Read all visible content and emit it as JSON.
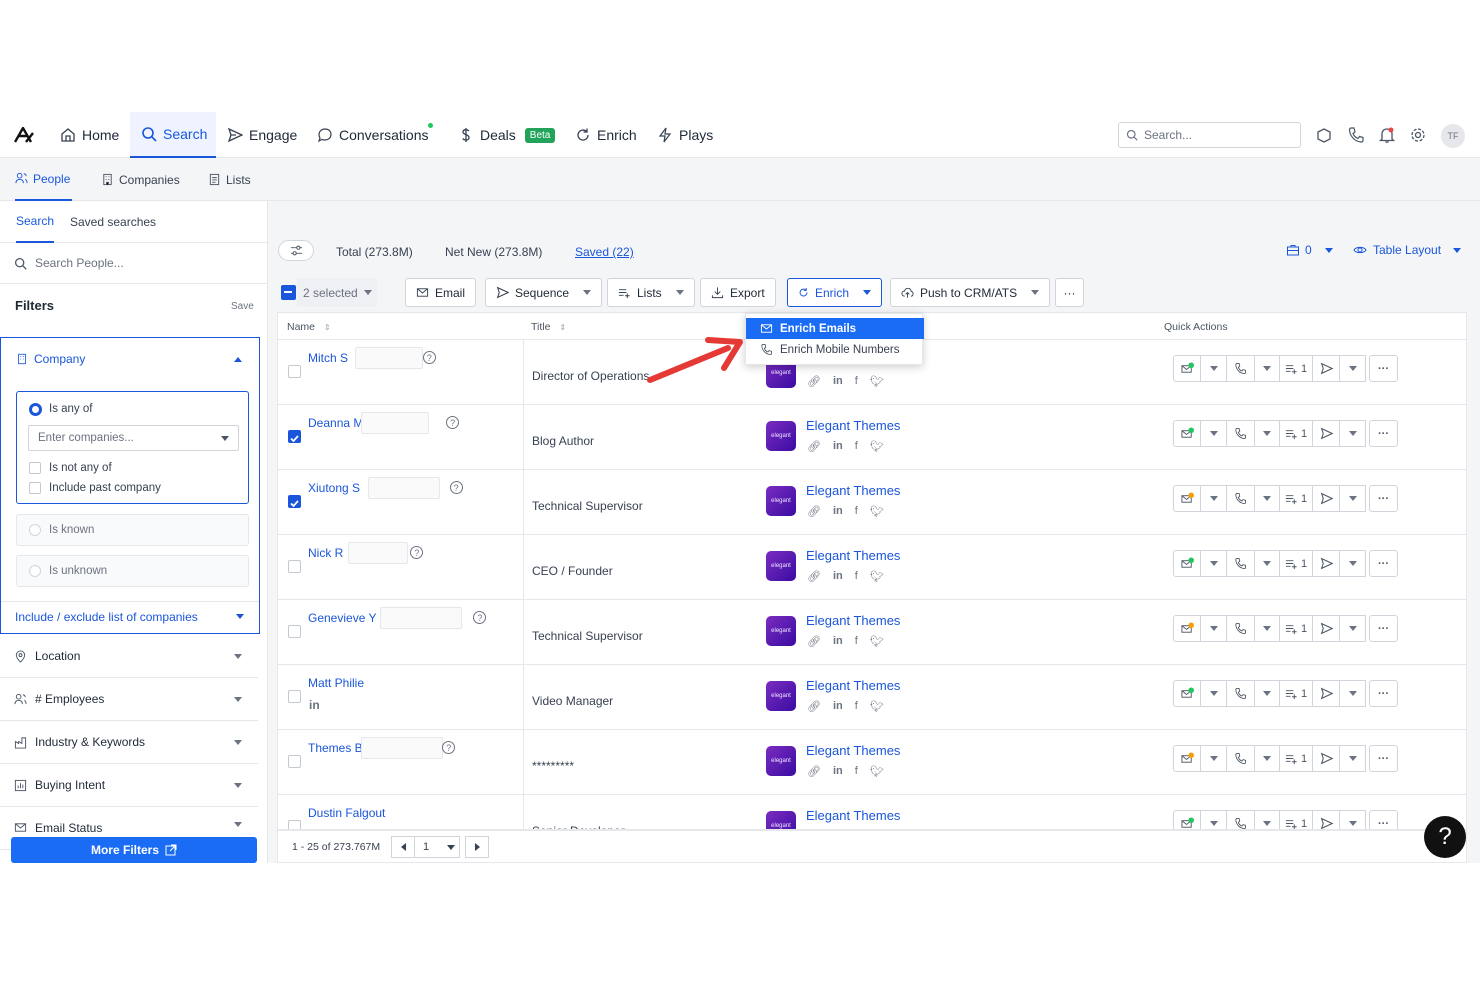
{
  "nav": {
    "items": [
      {
        "label": "Home",
        "icon": "home-icon"
      },
      {
        "label": "Search",
        "icon": "search-icon"
      },
      {
        "label": "Engage",
        "icon": "send-icon"
      },
      {
        "label": "Conversations",
        "icon": "chat-icon"
      },
      {
        "label": "Deals",
        "icon": "dollar-icon",
        "badge": "Beta"
      },
      {
        "label": "Enrich",
        "icon": "refresh-icon"
      },
      {
        "label": "Plays",
        "icon": "bolt-icon"
      }
    ],
    "search_placeholder": "Search...",
    "avatar": "TF"
  },
  "subnav": {
    "items": [
      "People",
      "Companies",
      "Lists"
    ]
  },
  "sidebar": {
    "tabs": [
      "Search",
      "Saved searches"
    ],
    "search_placeholder": "Search People...",
    "filters_title": "Filters",
    "save_label": "Save",
    "company": {
      "label": "Company",
      "is_any_of": "Is any of",
      "select_placeholder": "Enter companies...",
      "is_not_any_of": "Is not any of",
      "include_past": "Include past company",
      "is_known": "Is known",
      "is_unknown": "Is unknown",
      "include_exclude": "Include / exclude list of companies"
    },
    "filters": [
      "Location",
      "# Employees",
      "Industry & Keywords",
      "Buying Intent",
      "Email Status"
    ],
    "more_filters": "More Filters"
  },
  "stats": {
    "total": "Total (273.8M)",
    "net_new": "Net New (273.8M)",
    "saved": "Saved (22)",
    "credits": "0",
    "layout": "Table Layout"
  },
  "toolbar": {
    "selected": "2 selected",
    "email": "Email",
    "sequence": "Sequence",
    "lists": "Lists",
    "export": "Export",
    "enrich": "Enrich",
    "push": "Push to CRM/ATS",
    "more": "···"
  },
  "dropdown": {
    "items": [
      "Enrich Emails",
      "Enrich Mobile Numbers"
    ]
  },
  "table": {
    "headers": {
      "name": "Name",
      "title": "Title",
      "quick": "Quick Actions"
    },
    "rows": [
      {
        "name": "Mitch S",
        "title": "Director of Operations",
        "company": "",
        "checked": false,
        "email_status": "green"
      },
      {
        "name": "Deanna M",
        "title": "Blog Author",
        "company": "Elegant Themes",
        "checked": true,
        "email_status": "green"
      },
      {
        "name": "Xiutong S",
        "title": "Technical Supervisor",
        "company": "Elegant Themes",
        "checked": true,
        "email_status": "orange"
      },
      {
        "name": "Nick R",
        "title": "CEO / Founder",
        "company": "Elegant Themes",
        "checked": false,
        "email_status": "green"
      },
      {
        "name": "Genevieve Y",
        "title": "Technical Supervisor",
        "company": "Elegant Themes",
        "checked": false,
        "email_status": "orange"
      },
      {
        "name": "Matt Philie",
        "title": "Video Manager",
        "company": "Elegant Themes",
        "checked": false,
        "email_status": "green"
      },
      {
        "name": "Themes B",
        "title": "*********",
        "company": "Elegant Themes",
        "checked": false,
        "email_status": "orange"
      },
      {
        "name": "Dustin Falgout",
        "title": "Senior Developer",
        "company": "Elegant Themes",
        "checked": false,
        "email_status": "green"
      }
    ],
    "list_count": "1",
    "logo_text": "elegant"
  },
  "pager": {
    "range": "1 - 25 of 273.767M",
    "page": "1"
  },
  "help": "?"
}
